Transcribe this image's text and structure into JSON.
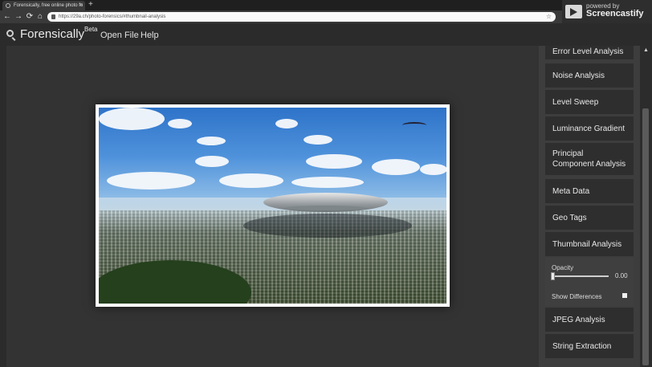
{
  "browser": {
    "tab_title": "Forensically, free online photo fo",
    "tab_close": "×",
    "new_tab": "+",
    "url": "https://29a.ch/photo-forensics/#thumbnail-analysis",
    "back": "←",
    "forward": "→",
    "reload": "⟳",
    "home": "⌂",
    "star": "☆"
  },
  "screencastify": {
    "powered_by": "powered by",
    "name": "Screencastify"
  },
  "app": {
    "brand": "Forensically",
    "brand_sup": "Beta",
    "menu": [
      {
        "label": "Open File"
      },
      {
        "label": "Help"
      }
    ]
  },
  "sidebar": {
    "items": [
      {
        "label": "Error Level Analysis"
      },
      {
        "label": "Noise Analysis"
      },
      {
        "label": "Level Sweep"
      },
      {
        "label": "Luminance Gradient"
      },
      {
        "label": "Principal Component Analysis"
      },
      {
        "label": "Meta Data"
      },
      {
        "label": "Geo Tags"
      },
      {
        "label": "Thumbnail Analysis"
      },
      {
        "label": "JPEG Analysis"
      },
      {
        "label": "String Extraction"
      }
    ],
    "tool_panel": {
      "opacity_label": "Opacity",
      "opacity_value": "0.00",
      "show_differences_label": "Show Differences"
    }
  },
  "scrollbar": {
    "up_arrow": "▲"
  }
}
